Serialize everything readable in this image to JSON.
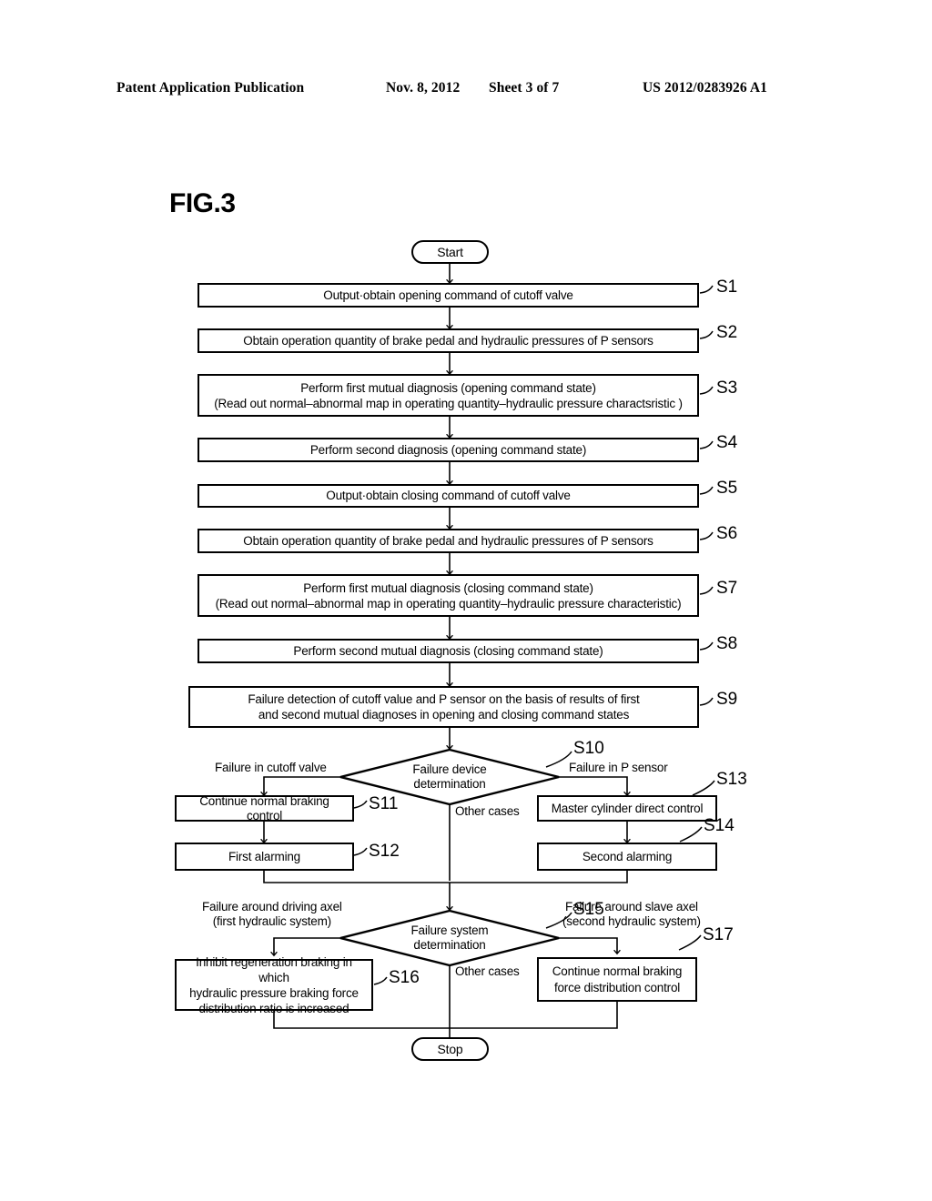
{
  "header": {
    "publication": "Patent Application Publication",
    "date": "Nov. 8, 2012",
    "sheet": "Sheet 3 of 7",
    "number": "US 2012/0283926 A1"
  },
  "figure": {
    "label": "FIG.3"
  },
  "flowchart": {
    "start": "Start",
    "stop": "Stop",
    "steps": {
      "s1": {
        "ref": "S1",
        "text": "Output·obtain opening command of cutoff valve"
      },
      "s2": {
        "ref": "S2",
        "text": "Obtain operation quantity of brake pedal and hydraulic pressures of  P sensors"
      },
      "s3": {
        "ref": "S3",
        "line1": "Perform first mutual diagnosis (opening command state)",
        "line2": "(Read out normal–abnormal map in operating quantity–hydraulic pressure charactsristic )"
      },
      "s4": {
        "ref": "S4",
        "text": "Perform second diagnosis (opening command state)"
      },
      "s5": {
        "ref": "S5",
        "text": "Output·obtain closing command of cutoff valve"
      },
      "s6": {
        "ref": "S6",
        "text": "Obtain operation quantity of brake pedal and hydraulic pressures of P sensors"
      },
      "s7": {
        "ref": "S7",
        "line1": "Perform first mutual diagnosis (closing command state)",
        "line2": "(Read out normal–abnormal map in operating quantity–hydraulic pressure characteristic)"
      },
      "s8": {
        "ref": "S8",
        "text": "Perform second mutual diagnosis (closing command state)"
      },
      "s9": {
        "ref": "S9",
        "line1": "Failure detection of cutoff value and P sensor on the basis of results of first",
        "line2": "and second mutual diagnoses in opening and closing command states"
      },
      "s10": {
        "ref": "S10",
        "line1": "Failure device",
        "line2": "determination"
      },
      "s11": {
        "ref": "S11",
        "text": "Continue normal braking control"
      },
      "s12": {
        "ref": "S12",
        "text": "First alarming"
      },
      "s13": {
        "ref": "S13",
        "text": "Master cylinder direct control"
      },
      "s14": {
        "ref": "S14",
        "text": "Second alarming"
      },
      "s15": {
        "ref": "S15",
        "line1": "Failure system",
        "line2": "determination"
      },
      "s16": {
        "ref": "S16",
        "line1": "Inhibit regeneration braking in which",
        "line2": "hydraulic pressure braking force",
        "line3": "distribution ratio is increased"
      },
      "s17": {
        "ref": "S17",
        "line1": "Continue normal braking",
        "line2": "force distribution control"
      }
    },
    "branches": {
      "s10_left": "Failure in cutoff valve",
      "s10_right": "Failure in P sensor",
      "s10_other": "Other cases",
      "s15_left_line1": "Failure around driving axel",
      "s15_left_line2": "(first hydraulic system)",
      "s15_right_line1": "Failure around slave axel",
      "s15_right_line2": "(second hydraulic system)",
      "s15_other": "Other cases"
    }
  }
}
